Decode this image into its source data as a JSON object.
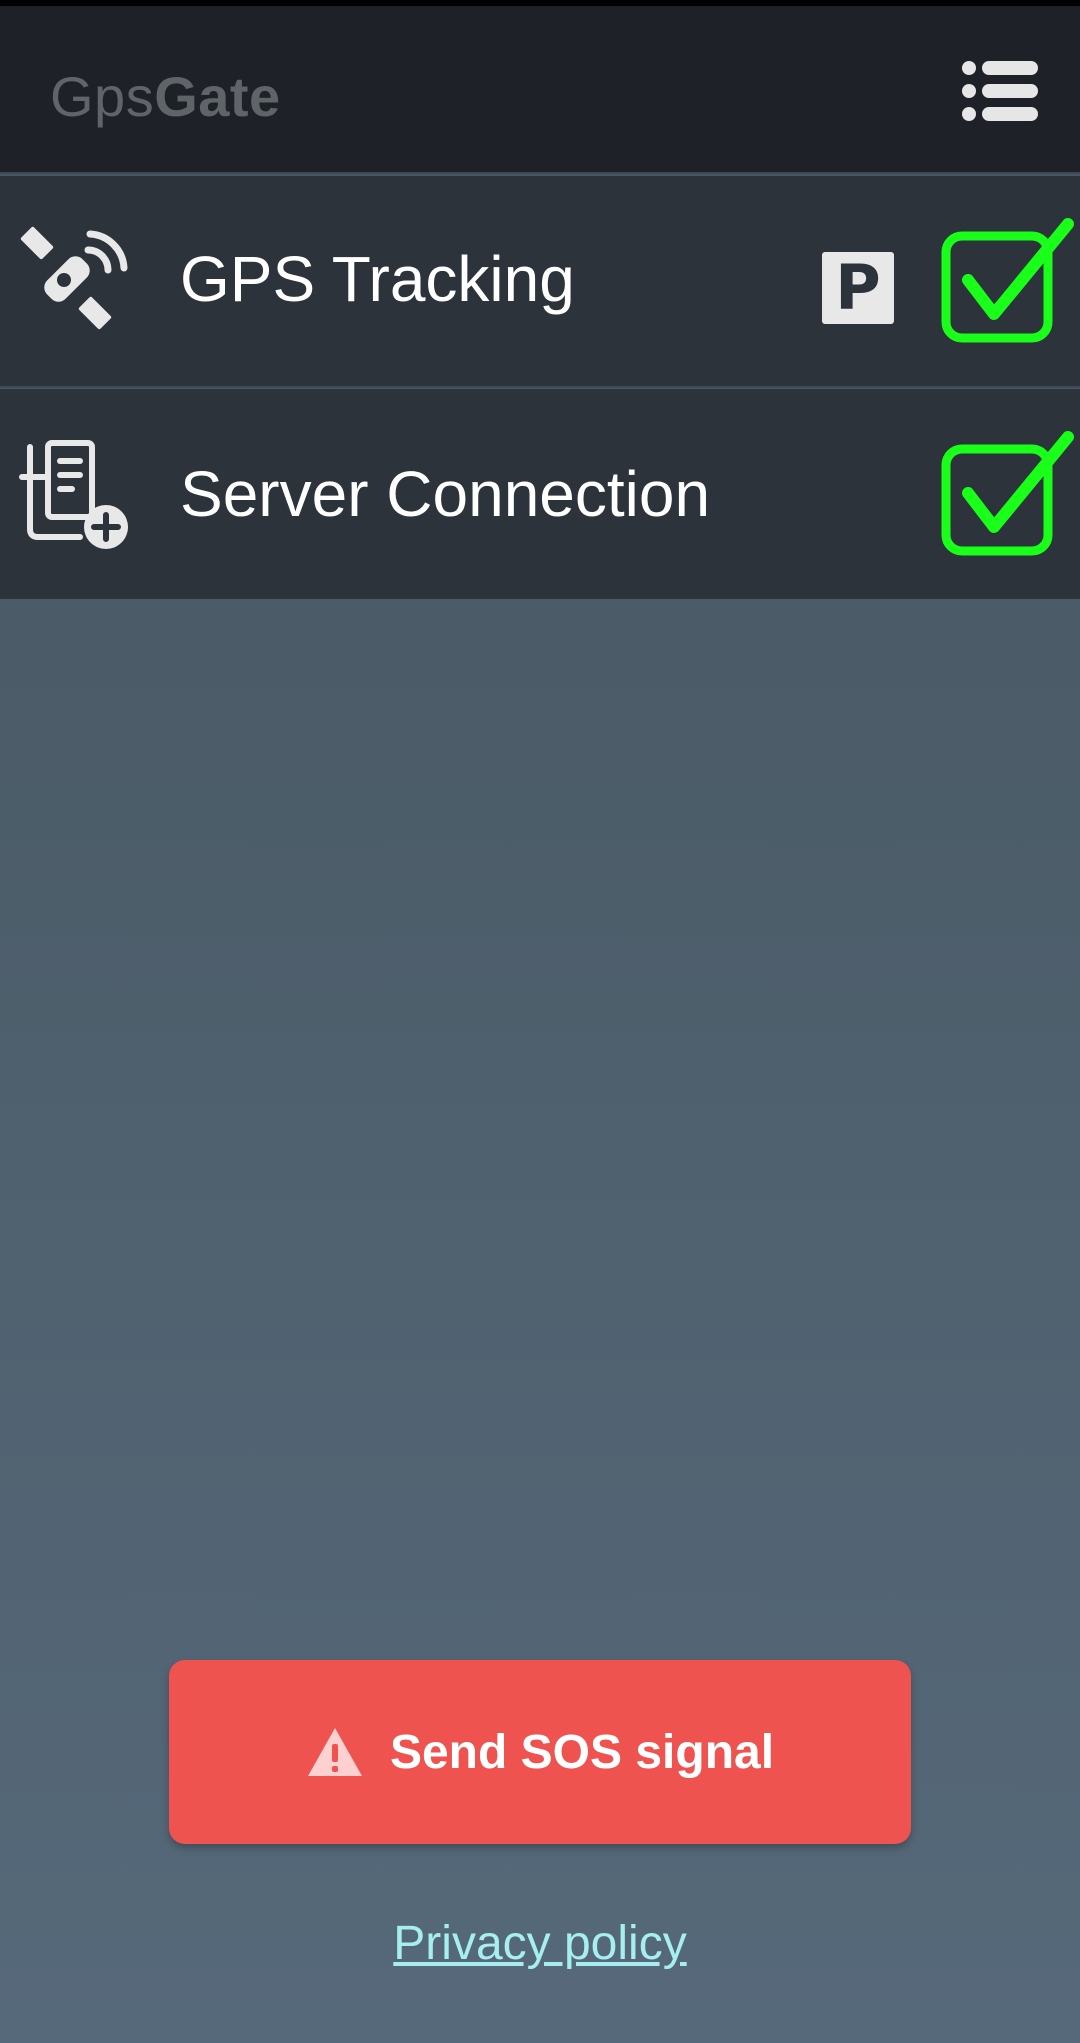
{
  "header": {
    "logo_part1": "Gps",
    "logo_part2": "Gate",
    "menu_icon": "list-menu-icon"
  },
  "rows": [
    {
      "icon": "satellite-icon",
      "label": "GPS Tracking",
      "badge": "P",
      "checked": true
    },
    {
      "icon": "server-add-icon",
      "label": "Server Connection",
      "checked": true
    }
  ],
  "sos": {
    "icon": "warning-icon",
    "label": "Send SOS signal"
  },
  "footer": {
    "privacy_label": "Privacy policy"
  },
  "colors": {
    "header_bg": "#1e2127",
    "row_bg": "#2c333b",
    "check_green": "#1aff1a",
    "sos_red": "#ef5350",
    "link": "#a6eef0"
  }
}
